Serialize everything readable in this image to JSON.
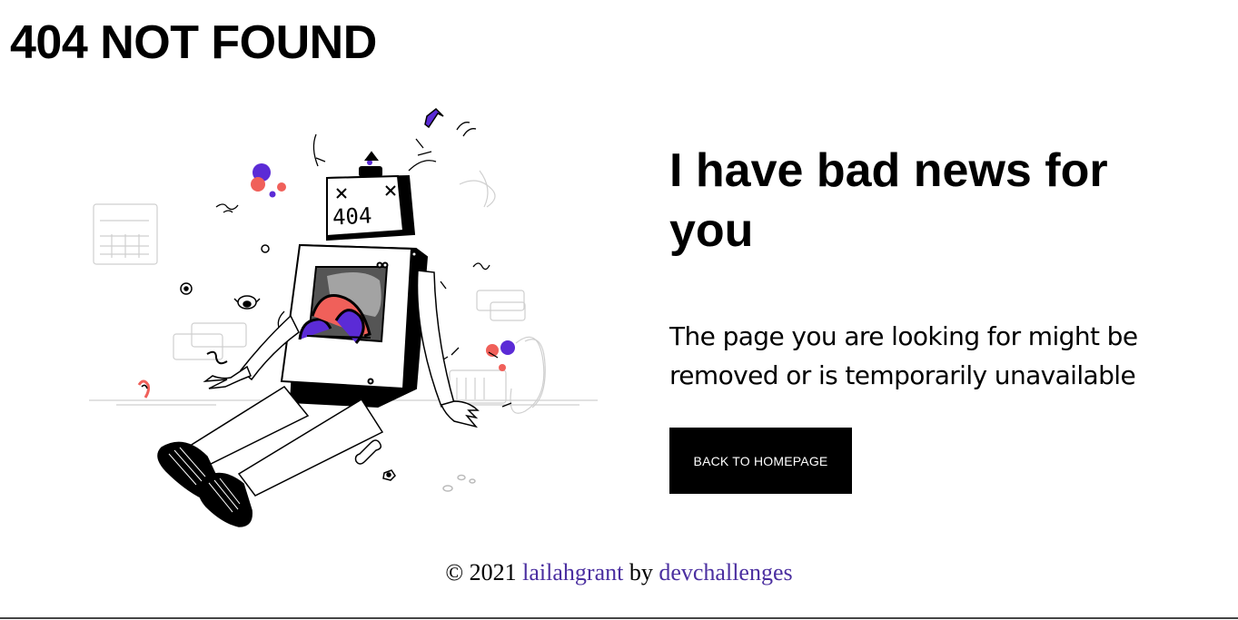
{
  "header": {
    "title": "404 NOT FOUND"
  },
  "illustration": {
    "icon": "broken-robot-illustration",
    "screen_text": "404"
  },
  "main": {
    "headline": "I have bad news for you",
    "message": "The page you are looking for might be removed or is temporarily unavailable",
    "button_label": "BACK TO HOMEPAGE"
  },
  "footer": {
    "prefix": "© 2021",
    "author": "lailahgrant",
    "by": "by",
    "platform": "devchallenges",
    "link_color": "#4b2fa0"
  },
  "colors": {
    "accent_purple": "#5b2bd6",
    "accent_coral": "#f0605a",
    "text": "#000000",
    "button_bg": "#000000",
    "button_text": "#ffffff"
  }
}
